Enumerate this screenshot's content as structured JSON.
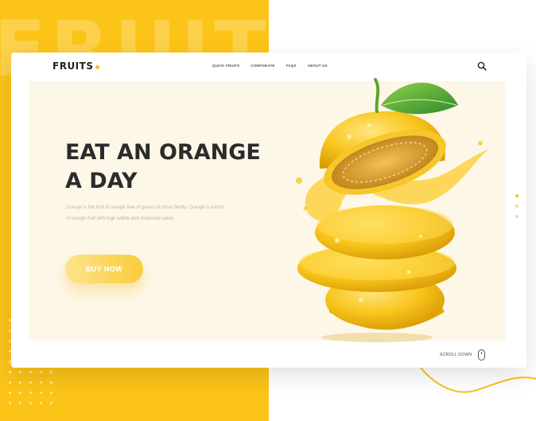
{
  "background": {
    "word": "FRUITS",
    "accent": "#fcc419"
  },
  "nav": {
    "logo": "FRUITS",
    "links": [
      "QUICK FRUITS",
      "CORPORATE",
      "FAQS",
      "ABOUT US"
    ],
    "search_icon": "search-icon"
  },
  "hero": {
    "title_line1": "EAT AN ORANGE",
    "title_line2": "A DAY",
    "description": "Orange is the fruit of orange tree of genus of citrus family. Orange is a kind of orange fruit with high edible and medicinal value.",
    "cta": "BUY NOW",
    "image": "sliced-orange-with-leaf"
  },
  "pager": {
    "count": 3,
    "active": 0
  },
  "scroll": {
    "label": "SCROLL DOWN",
    "icon": "mouse-icon"
  },
  "colors": {
    "brand": "#f6c026",
    "title": "#2b2b2b",
    "hero_bg": "#fdf7e8"
  }
}
